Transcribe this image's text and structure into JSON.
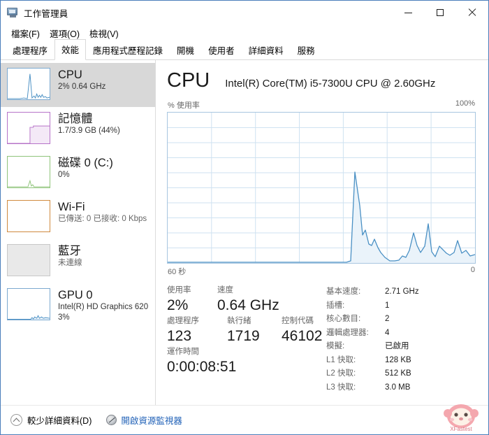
{
  "window": {
    "title": "工作管理員",
    "icon": "task-manager-icon",
    "minimize": "—",
    "maximize": "□",
    "close": "✕"
  },
  "menu": {
    "items": [
      {
        "label": "檔案(F)"
      },
      {
        "label": "選項(O)"
      },
      {
        "label": "檢視(V)"
      }
    ]
  },
  "tabs": [
    {
      "label": "處理程序",
      "active": false
    },
    {
      "label": "效能",
      "active": true
    },
    {
      "label": "應用程式歷程記錄",
      "active": false
    },
    {
      "label": "開機",
      "active": false
    },
    {
      "label": "使用者",
      "active": false
    },
    {
      "label": "詳細資料",
      "active": false
    },
    {
      "label": "服務",
      "active": false
    }
  ],
  "sidebar": {
    "items": [
      {
        "name": "cpu",
        "title": "CPU",
        "sub1": "2%  0.64 GHz",
        "sub2": "",
        "selected": true,
        "color": "#4a90c4"
      },
      {
        "name": "memory",
        "title": "記憶體",
        "sub1": "1.7/3.9 GB (44%)",
        "sub2": "",
        "selected": false,
        "color": "#b673c8"
      },
      {
        "name": "disk",
        "title": "磁碟 0 (C:)",
        "sub1": "0%",
        "sub2": "",
        "selected": false,
        "color": "#8fc47a"
      },
      {
        "name": "wifi",
        "title": "Wi-Fi",
        "sub1": "已傳送: 0 已接收: 0 Kbps",
        "sub2": "",
        "selected": false,
        "color": "#d08a3e"
      },
      {
        "name": "bluetooth",
        "title": "藍牙",
        "sub1": "未連線",
        "sub2": "",
        "selected": false,
        "color": "#c8c8c8"
      },
      {
        "name": "gpu",
        "title": "GPU 0",
        "sub1": "Intel(R) HD Graphics 620",
        "sub2": "3%",
        "selected": false,
        "color": "#4a90c4"
      }
    ]
  },
  "main": {
    "title": "CPU",
    "subtitle": "Intel(R) Core(TM) i5-7300U CPU @ 2.60GHz",
    "graph_top_left": "% 使用率",
    "graph_top_right": "100%",
    "graph_bottom_left": "60 秒",
    "graph_bottom_right": "0",
    "stats_left": [
      {
        "label": "使用率",
        "value": "2%"
      },
      {
        "label": "速度",
        "value": "0.64 GHz"
      },
      {
        "label": "處理程序",
        "value": "123"
      },
      {
        "label": "執行緒",
        "value": "1719"
      },
      {
        "label": "控制代碼",
        "value": "46102"
      },
      {
        "label": "運作時間",
        "value": "0:00:08:51"
      }
    ],
    "details": [
      {
        "key": "基本速度:",
        "value": "2.71 GHz"
      },
      {
        "key": "插槽:",
        "value": "1"
      },
      {
        "key": "核心數目:",
        "value": "2"
      },
      {
        "key": "邏輯處理器:",
        "value": "4"
      },
      {
        "key": "模擬:",
        "value": "已啟用"
      },
      {
        "key": "L1 快取:",
        "value": "128 KB"
      },
      {
        "key": "L2 快取:",
        "value": "512 KB"
      },
      {
        "key": "L3 快取:",
        "value": "3.0 MB"
      }
    ]
  },
  "footer": {
    "fewer_details": "較少詳細資料(D)",
    "resource_monitor": "開啟資源監視器"
  },
  "chart_data": {
    "type": "area",
    "title": "CPU % 使用率",
    "xlabel": "",
    "ylabel": "% 使用率",
    "xlim": [
      60,
      0
    ],
    "ylim": [
      0,
      100
    ],
    "x_tick_labels": [
      "60 秒",
      "0"
    ],
    "y_tick_labels": [
      "100%"
    ],
    "grid": true,
    "grid_columns": 6,
    "grid_rows": 10,
    "line_color": "#4a90c4",
    "fill_color": "#eaf3fa",
    "series": [
      {
        "name": "CPU 使用率",
        "x": [
          60,
          59,
          58,
          57,
          56,
          55,
          54,
          53,
          52,
          51,
          50,
          49,
          48,
          47,
          46,
          45,
          44,
          43,
          42,
          41,
          40,
          39,
          38,
          37,
          36,
          35,
          34,
          33,
          32,
          31,
          30,
          29,
          28,
          27,
          26,
          25,
          24,
          23,
          22,
          21,
          20,
          19,
          18,
          17,
          16,
          15,
          14,
          13,
          12,
          11,
          10,
          9,
          8,
          7,
          6,
          5,
          4,
          3,
          2,
          1,
          0
        ],
        "values": [
          0,
          0,
          0,
          0,
          0,
          0,
          0,
          0,
          0,
          0,
          0,
          0,
          0,
          0,
          0,
          0,
          0,
          0,
          0,
          0,
          0,
          0,
          0,
          0,
          0,
          0,
          0,
          0,
          0,
          0,
          0,
          0,
          0,
          0,
          0,
          0,
          0,
          0,
          0,
          1,
          60,
          32,
          12,
          16,
          11,
          14,
          8,
          10,
          7,
          3,
          1,
          1,
          1,
          2,
          6,
          4,
          9,
          20,
          7,
          5,
          11,
          26,
          7,
          4,
          12,
          9,
          7,
          6,
          5,
          4,
          6,
          13,
          4
        ]
      }
    ]
  }
}
